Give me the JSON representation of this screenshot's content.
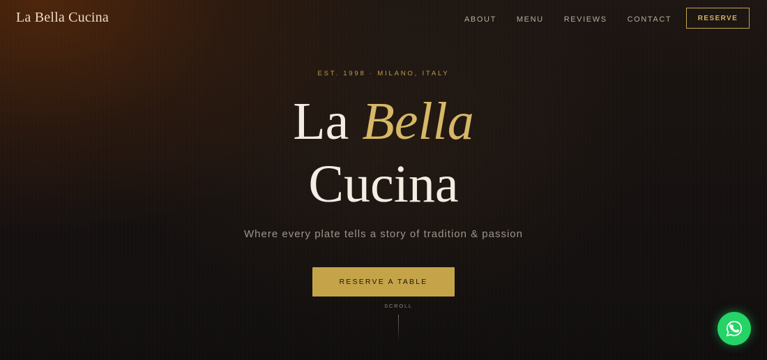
{
  "header": {
    "brand": "La Bella Cucina",
    "nav": [
      "ABOUT",
      "MENU",
      "REVIEWS",
      "CONTACT"
    ],
    "reserve_label": "RESERVE"
  },
  "hero": {
    "eyebrow": "EST. 1998 · MILANO, ITALY",
    "title_line1_plain": "La ",
    "title_line1_accent": "Bella",
    "title_line2": "Cucina",
    "tagline": "Where every plate tells a story of tradition & passion",
    "cta_label": "RESERVE A TABLE",
    "scroll_label": "SCROLL"
  },
  "chat": {
    "icon": "whatsapp-icon"
  },
  "colors": {
    "accent_gold": "#c5a449",
    "background": "#121010",
    "chat_green": "#25d366"
  }
}
